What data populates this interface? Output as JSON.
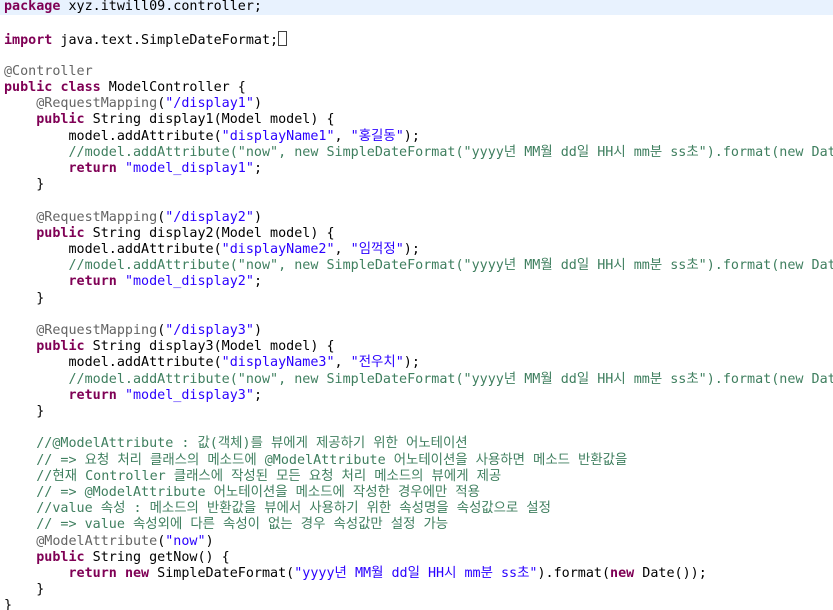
{
  "editor": {
    "file_type": "java",
    "colors": {
      "keyword": "#7f0055",
      "string": "#2a00ff",
      "comment": "#3f7f5f",
      "annotation": "#646464",
      "current_line": "#e8f2fe"
    },
    "lines": [
      [
        [
          "kw",
          "package"
        ],
        [
          "t",
          " xyz.itwill09.controller;"
        ]
      ],
      [],
      [
        [
          "kw",
          "import"
        ],
        [
          "t",
          " java.text.SimpleDateFormat;"
        ],
        [
          "cursor",
          ""
        ]
      ],
      [],
      [
        [
          "ann",
          "@Controller"
        ]
      ],
      [
        [
          "kw",
          "public"
        ],
        [
          "t",
          " "
        ],
        [
          "kw",
          "class"
        ],
        [
          "t",
          " ModelController {"
        ]
      ],
      [
        [
          "t",
          "    "
        ],
        [
          "ann",
          "@RequestMapping"
        ],
        [
          "t",
          "("
        ],
        [
          "str",
          "\"/display1\""
        ],
        [
          "t",
          ")"
        ]
      ],
      [
        [
          "t",
          "    "
        ],
        [
          "kw",
          "public"
        ],
        [
          "t",
          " String display1(Model model) {"
        ]
      ],
      [
        [
          "t",
          "        model.addAttribute("
        ],
        [
          "str",
          "\"displayName1\""
        ],
        [
          "t",
          ", "
        ],
        [
          "str",
          "\"홍길동\""
        ],
        [
          "t",
          ");"
        ]
      ],
      [
        [
          "t",
          "        "
        ],
        [
          "com",
          "//model.addAttribute(\"now\", new SimpleDateFormat(\"yyyy년 MM월 dd일 HH시 mm분 ss초\").format(new Date()));"
        ]
      ],
      [
        [
          "t",
          "        "
        ],
        [
          "kw",
          "return"
        ],
        [
          "t",
          " "
        ],
        [
          "str",
          "\"model_display1\""
        ],
        [
          "t",
          ";"
        ]
      ],
      [
        [
          "t",
          "    }"
        ]
      ],
      [],
      [
        [
          "t",
          "    "
        ],
        [
          "ann",
          "@RequestMapping"
        ],
        [
          "t",
          "("
        ],
        [
          "str",
          "\"/display2\""
        ],
        [
          "t",
          ")"
        ]
      ],
      [
        [
          "t",
          "    "
        ],
        [
          "kw",
          "public"
        ],
        [
          "t",
          " String display2(Model model) {"
        ]
      ],
      [
        [
          "t",
          "        model.addAttribute("
        ],
        [
          "str",
          "\"displayName2\""
        ],
        [
          "t",
          ", "
        ],
        [
          "str",
          "\"임꺽정\""
        ],
        [
          "t",
          ");"
        ]
      ],
      [
        [
          "t",
          "        "
        ],
        [
          "com",
          "//model.addAttribute(\"now\", new SimpleDateFormat(\"yyyy년 MM월 dd일 HH시 mm분 ss초\").format(new Date()));"
        ]
      ],
      [
        [
          "t",
          "        "
        ],
        [
          "kw",
          "return"
        ],
        [
          "t",
          " "
        ],
        [
          "str",
          "\"model_display2\""
        ],
        [
          "t",
          ";"
        ]
      ],
      [
        [
          "t",
          "    }"
        ]
      ],
      [],
      [
        [
          "t",
          "    "
        ],
        [
          "ann",
          "@RequestMapping"
        ],
        [
          "t",
          "("
        ],
        [
          "str",
          "\"/display3\""
        ],
        [
          "t",
          ")"
        ]
      ],
      [
        [
          "t",
          "    "
        ],
        [
          "kw",
          "public"
        ],
        [
          "t",
          " String display3(Model model) {"
        ]
      ],
      [
        [
          "t",
          "        model.addAttribute("
        ],
        [
          "str",
          "\"displayName3\""
        ],
        [
          "t",
          ", "
        ],
        [
          "str",
          "\"전우치\""
        ],
        [
          "t",
          ");"
        ]
      ],
      [
        [
          "t",
          "        "
        ],
        [
          "com",
          "//model.addAttribute(\"now\", new SimpleDateFormat(\"yyyy년 MM월 dd일 HH시 mm분 ss초\").format(new Date()));"
        ]
      ],
      [
        [
          "t",
          "        "
        ],
        [
          "kw",
          "return"
        ],
        [
          "t",
          " "
        ],
        [
          "str",
          "\"model_display3\""
        ],
        [
          "t",
          ";"
        ]
      ],
      [
        [
          "t",
          "    }"
        ]
      ],
      [],
      [
        [
          "t",
          "    "
        ],
        [
          "com",
          "//@ModelAttribute : 값(객체)를 뷰에게 제공하기 위한 어노테이션"
        ]
      ],
      [
        [
          "t",
          "    "
        ],
        [
          "com",
          "// => 요청 처리 클래스의 메소드에 @ModelAttribute 어노테이션을 사용하면 메소드 반환값을"
        ]
      ],
      [
        [
          "t",
          "    "
        ],
        [
          "com",
          "//현재 Controller 클래스에 작성된 모든 요청 처리 메소드의 뷰에게 제공"
        ]
      ],
      [
        [
          "t",
          "    "
        ],
        [
          "com",
          "// => @ModelAttribute 어노테이션을 메소드에 작성한 경우에만 적용"
        ]
      ],
      [
        [
          "t",
          "    "
        ],
        [
          "com",
          "//value 속성 : 메소드의 반환값을 뷰에서 사용하기 위한 속성명을 속성값으로 설정"
        ]
      ],
      [
        [
          "t",
          "    "
        ],
        [
          "com",
          "// => value 속성외에 다른 속성이 없는 경우 속성값만 설정 가능"
        ]
      ],
      [
        [
          "t",
          "    "
        ],
        [
          "ann",
          "@ModelAttribute"
        ],
        [
          "t",
          "("
        ],
        [
          "str",
          "\"now\""
        ],
        [
          "t",
          ")"
        ]
      ],
      [
        [
          "t",
          "    "
        ],
        [
          "kw",
          "public"
        ],
        [
          "t",
          " String getNow() {"
        ]
      ],
      [
        [
          "t",
          "        "
        ],
        [
          "kw",
          "return"
        ],
        [
          "t",
          " "
        ],
        [
          "kw",
          "new"
        ],
        [
          "t",
          " SimpleDateFormat("
        ],
        [
          "str",
          "\"yyyy년 MM월 dd일 HH시 mm분 ss초\""
        ],
        [
          "t",
          ").format("
        ],
        [
          "kw",
          "new"
        ],
        [
          "t",
          " Date());"
        ]
      ],
      [
        [
          "t",
          "    }"
        ]
      ],
      [
        [
          "t",
          "}"
        ]
      ]
    ]
  }
}
